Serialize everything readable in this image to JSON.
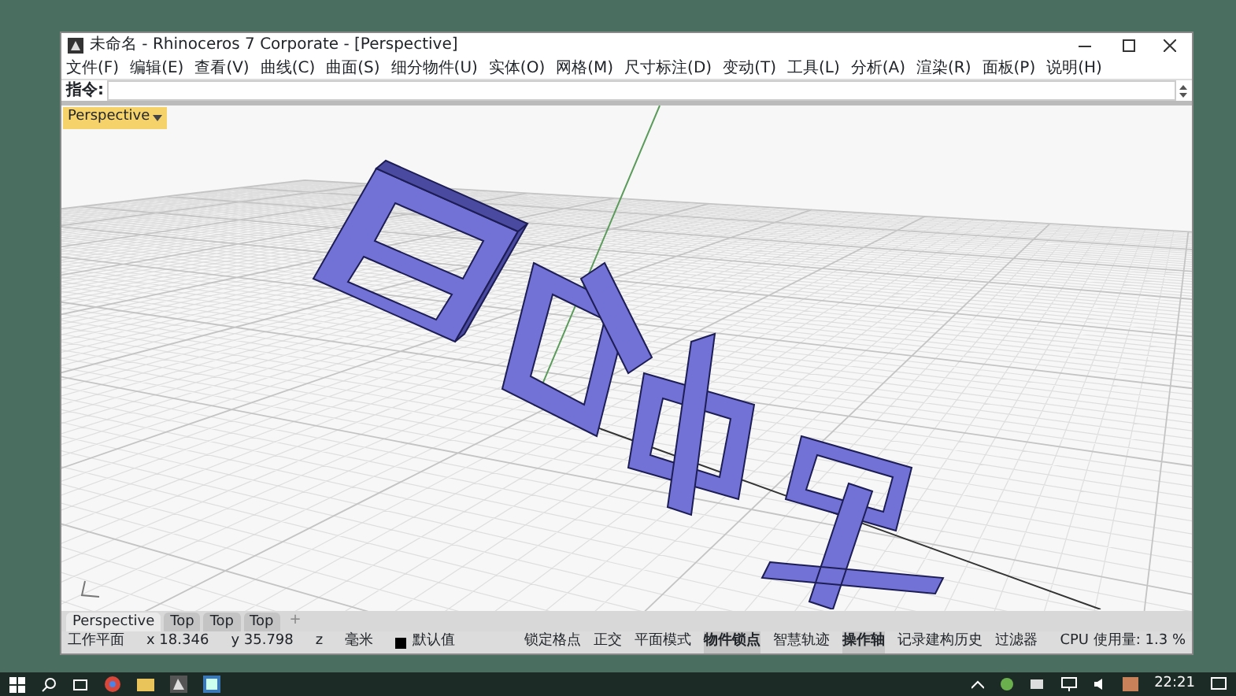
{
  "window": {
    "title": "未命名 - Rhinoceros 7 Corporate - [Perspective]"
  },
  "menu": [
    "文件(F)",
    "编辑(E)",
    "查看(V)",
    "曲线(C)",
    "曲面(S)",
    "细分物件(U)",
    "实体(O)",
    "网格(M)",
    "尺寸标注(D)",
    "变动(T)",
    "工具(L)",
    "分析(A)",
    "渲染(R)",
    "面板(P)",
    "说明(H)"
  ],
  "command": {
    "label": "指令:"
  },
  "viewport": {
    "label": "Perspective"
  },
  "viewport_tabs": [
    {
      "label": "Perspective",
      "selected": true
    },
    {
      "label": "Top",
      "selected": false
    },
    {
      "label": "Top",
      "selected": false
    },
    {
      "label": "Top",
      "selected": false
    }
  ],
  "add_tab": "+",
  "status_bar": {
    "cplane": "工作平面",
    "x": "x 18.346",
    "y": "y 35.798",
    "z": "z",
    "units": "毫米",
    "layer": "默认值",
    "toggles": [
      {
        "label": "锁定格点",
        "on": false
      },
      {
        "label": "正交",
        "on": false
      },
      {
        "label": "平面模式",
        "on": false
      },
      {
        "label": "物件锁点",
        "on": true
      },
      {
        "label": "智慧轨迹",
        "on": false
      },
      {
        "label": "操作轴",
        "on": true
      },
      {
        "label": "记录建构历史",
        "on": false
      },
      {
        "label": "过滤器",
        "on": false
      }
    ],
    "cpu": "CPU 使用量: 1.3 %"
  },
  "taskbar": {
    "time": "22:21"
  }
}
